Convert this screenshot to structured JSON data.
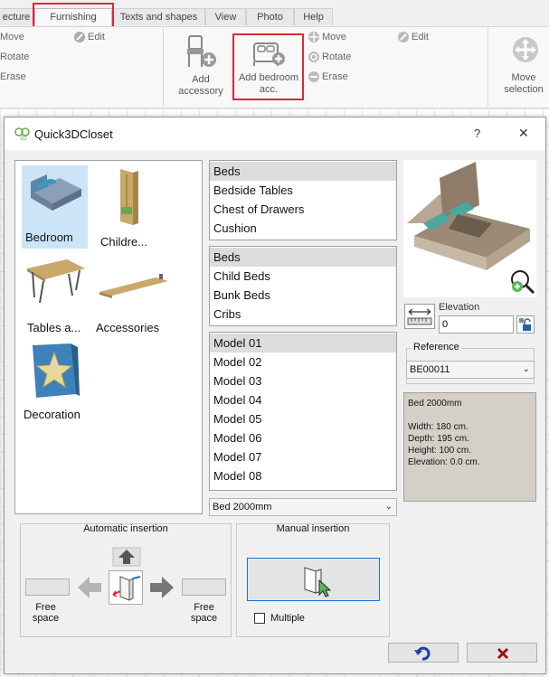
{
  "ribbon": {
    "tabs": [
      "ecture",
      "Furnishing",
      "Texts and shapes",
      "View",
      "Photo",
      "Help"
    ],
    "left_group": {
      "move": "Move",
      "rotate": "Rotate",
      "erase": "Erase",
      "edit": "Edit"
    },
    "add_accessory": "Add accessory",
    "add_bedroom": "Add bedroom acc.",
    "mid_group": {
      "move": "Move",
      "rotate": "Rotate",
      "erase": "Erase",
      "edit": "Edit"
    },
    "move_selection": "Move selection"
  },
  "dialog": {
    "title": "Quick3DCloset",
    "help": "?",
    "close": "✕",
    "categories": [
      {
        "label": "Bedroom",
        "icon": "bed-icon"
      },
      {
        "label": "Childre...",
        "icon": "wardrobe-icon"
      },
      {
        "label": "Tables a...",
        "icon": "table-icon"
      },
      {
        "label": "Accessories",
        "icon": "shelf-icon"
      },
      {
        "label": "Decoration",
        "icon": "star-decoration-icon"
      }
    ],
    "list1": [
      "Beds",
      "Bedside Tables",
      "Chest of Drawers",
      "Cushion"
    ],
    "list2": [
      "Beds",
      "Child Beds",
      "Bunk Beds",
      "Cribs"
    ],
    "list3": [
      "Model 01",
      "Model 02",
      "Model 03",
      "Model 04",
      "Model 05",
      "Model 06",
      "Model 07",
      "Model 08"
    ],
    "model_select": "Bed 2000mm",
    "elevation_label": "Elevation",
    "elevation_value": "0",
    "reference_label": "Reference",
    "reference_value": "BE00011",
    "info": {
      "name": "Bed 2000mm",
      "width": "Width: 180 cm.",
      "depth": "Depth: 195 cm.",
      "height": "Height: 100 cm.",
      "elevation": "Elevation: 0.0 cm."
    },
    "auto_insertion": "Automatic insertion",
    "manual_insertion": "Manual insertion",
    "free_space_left": "Free space",
    "free_space_right": "Free space",
    "multiple": "Multiple"
  },
  "colors": {
    "highlight": "#e0263c",
    "selection": "#cce4f7",
    "accent": "#1f6fd0"
  }
}
